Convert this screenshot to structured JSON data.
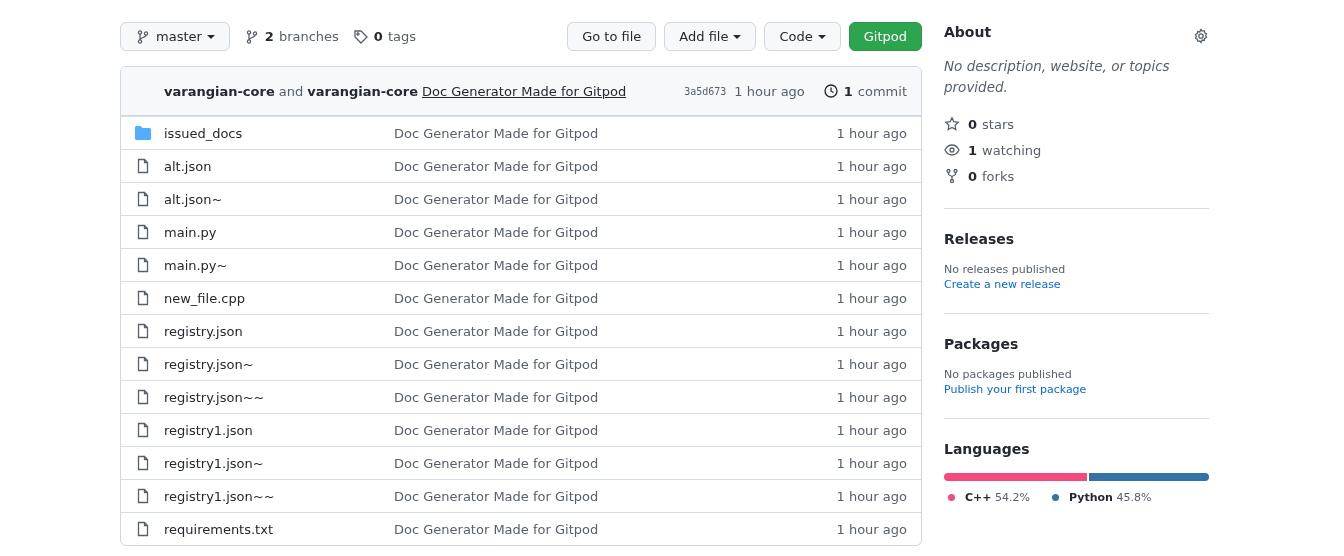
{
  "toolbar": {
    "branch": "master",
    "branches_count": "2",
    "branches_label": "branches",
    "tags_count": "0",
    "tags_label": "tags",
    "buttons": [
      {
        "label": "Go to file",
        "kind": "plain"
      },
      {
        "label": "Add file",
        "kind": "dropdown"
      },
      {
        "label": "Code",
        "kind": "dropdown"
      },
      {
        "label": "Gitpod",
        "kind": "primary"
      }
    ]
  },
  "commit_header": {
    "author": "varangian-core",
    "joiner": "and",
    "coauthor": "varangian-core",
    "message": "Doc Generator Made for Gitpod",
    "sha": "3a5d673",
    "time": "1 hour ago",
    "commits_count": "1",
    "commits_label": "commit"
  },
  "files": [
    {
      "name": "issued_docs",
      "kind": "folder",
      "message": "Doc Generator Made for Gitpod",
      "time": "1 hour ago"
    },
    {
      "name": "alt.json",
      "kind": "file",
      "message": "Doc Generator Made for Gitpod",
      "time": "1 hour ago"
    },
    {
      "name": "alt.json~",
      "kind": "file",
      "message": "Doc Generator Made for Gitpod",
      "time": "1 hour ago"
    },
    {
      "name": "main.py",
      "kind": "file",
      "message": "Doc Generator Made for Gitpod",
      "time": "1 hour ago"
    },
    {
      "name": "main.py~",
      "kind": "file",
      "message": "Doc Generator Made for Gitpod",
      "time": "1 hour ago"
    },
    {
      "name": "new_file.cpp",
      "kind": "file",
      "message": "Doc Generator Made for Gitpod",
      "time": "1 hour ago"
    },
    {
      "name": "registry.json",
      "kind": "file",
      "message": "Doc Generator Made for Gitpod",
      "time": "1 hour ago"
    },
    {
      "name": "registry.json~",
      "kind": "file",
      "message": "Doc Generator Made for Gitpod",
      "time": "1 hour ago"
    },
    {
      "name": "registry.json~~",
      "kind": "file",
      "message": "Doc Generator Made for Gitpod",
      "time": "1 hour ago"
    },
    {
      "name": "registry1.json",
      "kind": "file",
      "message": "Doc Generator Made for Gitpod",
      "time": "1 hour ago"
    },
    {
      "name": "registry1.json~",
      "kind": "file",
      "message": "Doc Generator Made for Gitpod",
      "time": "1 hour ago"
    },
    {
      "name": "registry1.json~~",
      "kind": "file",
      "message": "Doc Generator Made for Gitpod",
      "time": "1 hour ago"
    },
    {
      "name": "requirements.txt",
      "kind": "file",
      "message": "Doc Generator Made for Gitpod",
      "time": "1 hour ago"
    }
  ],
  "about": {
    "title": "About",
    "description": "No description, website, or topics provided.",
    "stats": [
      {
        "kind": "star",
        "count": "0",
        "label": "stars"
      },
      {
        "kind": "eye",
        "count": "1",
        "label": "watching"
      },
      {
        "kind": "fork",
        "count": "0",
        "label": "forks"
      }
    ]
  },
  "releases": {
    "title": "Releases",
    "note": "No releases published",
    "link": "Create a new release"
  },
  "packages": {
    "title": "Packages",
    "note": "No packages published",
    "link": "Publish your first package"
  },
  "languages": {
    "title": "Languages",
    "items": [
      {
        "name": "C++",
        "percent": "54.2%",
        "color": "#f34b7d",
        "level": 0.542
      },
      {
        "name": "Python",
        "percent": "45.8%",
        "color": "#3572a5",
        "level": 0.458
      }
    ]
  }
}
